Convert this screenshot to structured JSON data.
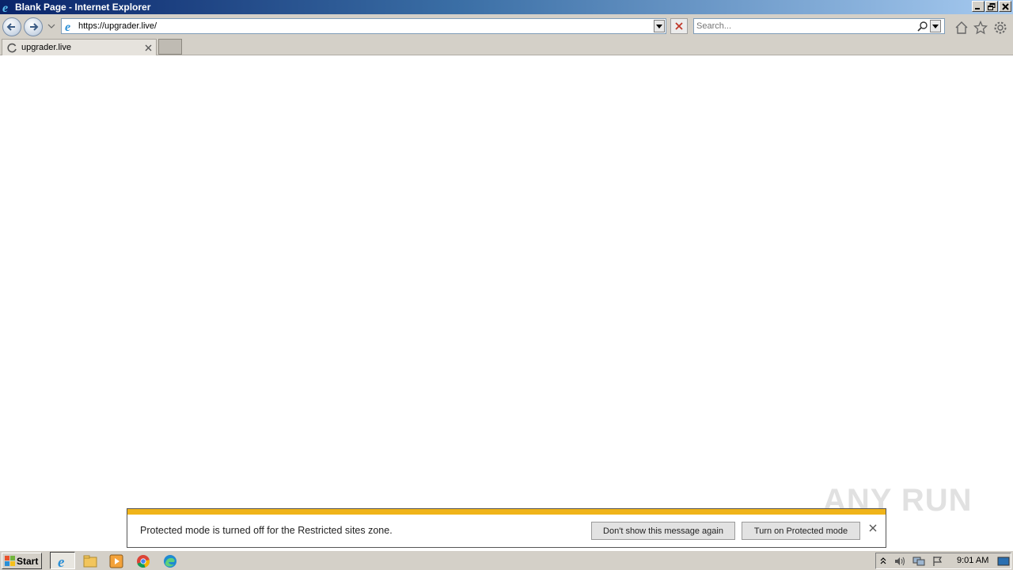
{
  "window": {
    "title": "Blank Page - Internet Explorer"
  },
  "nav": {
    "url": "https://upgrader.live/",
    "search_placeholder": "Search..."
  },
  "tabs": [
    {
      "label": "upgrader.live"
    }
  ],
  "notification": {
    "message": "Protected mode is turned off for the Restricted sites zone.",
    "dont_show_label": "Don't show this message again",
    "turn_on_label": "Turn on Protected mode",
    "accent_color": "#f0b41a"
  },
  "watermark": {
    "text": "ANY RUN"
  },
  "taskbar": {
    "start_label": "Start",
    "clock": "9:01 AM",
    "pinned": [
      "internet-explorer-icon",
      "file-explorer-icon",
      "media-player-icon",
      "chrome-icon",
      "edge-icon"
    ]
  }
}
